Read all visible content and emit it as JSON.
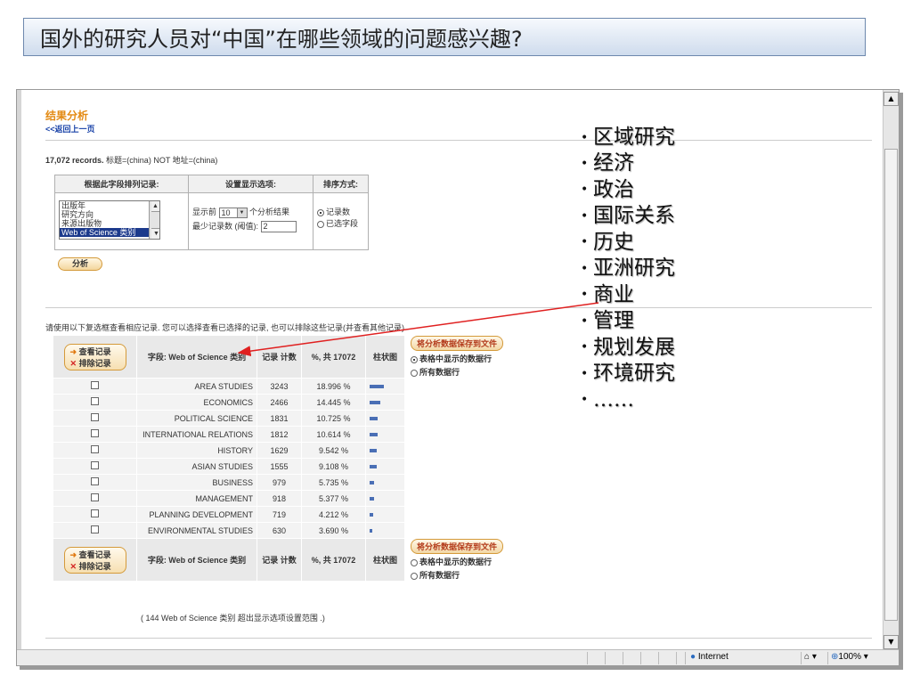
{
  "slide": {
    "title": "国外的研究人员对“中国”在哪些领域的问题感兴趣?"
  },
  "page": {
    "heading": "结果分析",
    "back_link": "<<返回上一页",
    "records_count": "17,072 records.",
    "records_query": " 标题=(china) NOT 地址=(china)",
    "options": {
      "col1_header": "根据此字段排列记录:",
      "col2_header": "设置显示选项:",
      "col3_header": "排序方式:",
      "list_items": [
        "出版年",
        "研究方向",
        "来源出版物",
        "Web of Science 类别"
      ],
      "show_top_label": "显示前",
      "show_top_value": "10",
      "show_top_suffix": "个分析结果",
      "min_records_label": "最少记录数 (阈值):",
      "min_records_value": "2",
      "sort_by_count": "记录数",
      "sort_by_field": "已选字段"
    },
    "analyze_button": "分析",
    "instruction": "请使用以下复选框查看相应记录. 您可以选择查看已选择的记录, 也可以排除这些记录(并查看其他记录)",
    "view_records": "查看记录",
    "exclude_records": "排除记录",
    "col_field": "字段: Web of Science 类别",
    "col_count": "记录 计数",
    "col_pct": "%, 共 17072",
    "col_bar": "柱状图",
    "save_button": "将分析数据保存到文件",
    "save_option_table": "表格中显示的数据行",
    "save_option_all": "所有数据行",
    "footnote": "( 144 Web of Science 类别 超出显示选项设置范围 .)"
  },
  "chart_data": {
    "type": "table",
    "columns": [
      "字段: Web of Science 类别",
      "记录 计数",
      "%, 共 17072",
      "柱状图"
    ],
    "rows": [
      {
        "category": "AREA STUDIES",
        "count": 3243,
        "percent": "18.996 %"
      },
      {
        "category": "ECONOMICS",
        "count": 2466,
        "percent": "14.445 %"
      },
      {
        "category": "POLITICAL SCIENCE",
        "count": 1831,
        "percent": "10.725 %"
      },
      {
        "category": "INTERNATIONAL RELATIONS",
        "count": 1812,
        "percent": "10.614 %"
      },
      {
        "category": "HISTORY",
        "count": 1629,
        "percent": "9.542 %"
      },
      {
        "category": "ASIAN STUDIES",
        "count": 1555,
        "percent": "9.108 %"
      },
      {
        "category": "BUSINESS",
        "count": 979,
        "percent": "5.735 %"
      },
      {
        "category": "MANAGEMENT",
        "count": 918,
        "percent": "5.377 %"
      },
      {
        "category": "PLANNING DEVELOPMENT",
        "count": 719,
        "percent": "4.212 %"
      },
      {
        "category": "ENVIRONMENTAL STUDIES",
        "count": 630,
        "percent": "3.690 %"
      }
    ],
    "bar_color": "#4a6fb5"
  },
  "bullets": [
    "区域研究",
    "经济",
    "政治",
    "国际关系",
    "历史",
    "亚洲研究",
    "商业",
    "管理",
    "规划发展",
    "环境研究",
    "……"
  ],
  "browser_status": {
    "zone": "Internet",
    "zoom": "100%"
  },
  "colors": {
    "heading": "#e38a13",
    "link": "#1a43a8",
    "annotation_arrow": "#e02020",
    "banner_border": "#6d88ad"
  }
}
